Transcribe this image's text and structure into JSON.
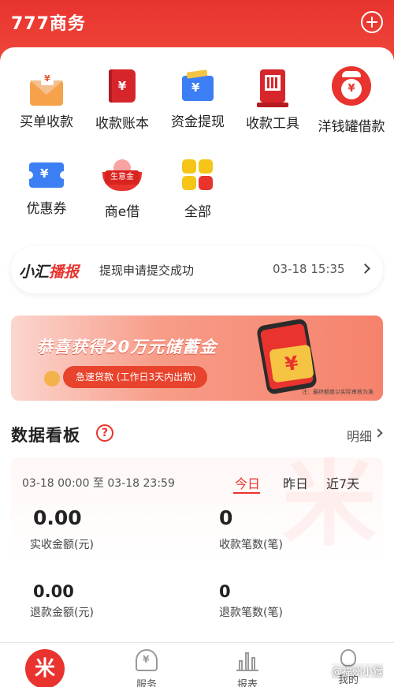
{
  "header": {
    "title": "777商务"
  },
  "services": [
    {
      "label": "买单收款",
      "glyph": "¥"
    },
    {
      "label": "收款账本",
      "glyph": "¥"
    },
    {
      "label": "资金提现",
      "glyph": "¥"
    },
    {
      "label": "收款工具",
      "glyph": ""
    },
    {
      "label": "洋钱罐借款",
      "glyph": "¥"
    },
    {
      "label": "优惠券",
      "glyph": "¥"
    },
    {
      "label": "商e借",
      "glyph": "生意金"
    },
    {
      "label": "全部",
      "glyph": ""
    }
  ],
  "broadcast": {
    "logo_black": "小汇",
    "logo_red": "播报",
    "message": "提现申请提交成功",
    "time": "03-18 15:35"
  },
  "banner": {
    "title": "恭喜获得20万元储蓄金",
    "pill": "急速贷款 (工作日3天内出款)",
    "yuan": "¥",
    "note": "注：最终额度以实际审核为准"
  },
  "dashboard": {
    "title": "数据看板",
    "help": "?",
    "detail": "明细",
    "date_range": "03-18 00:00 至 03-18 23:59",
    "tabs": [
      "今日",
      "昨日",
      "近7天"
    ],
    "active_tab": "今日",
    "watermark": "米",
    "stats": [
      {
        "value": "0.00",
        "label": "实收金额(元)"
      },
      {
        "value": "0",
        "label": "收款笔数(笔)"
      },
      {
        "value": "0.00",
        "label": "退款金额(元)"
      },
      {
        "value": "0",
        "label": "退款笔数(笔)"
      }
    ]
  },
  "tabbar": {
    "home_glyph": "米",
    "items": [
      {
        "label": "服务",
        "icon": "heart-yuan-icon",
        "glyph": "¥"
      },
      {
        "label": "报表",
        "icon": "bar-chart-icon"
      },
      {
        "label": "我的",
        "icon": "person-icon"
      }
    ]
  },
  "overlay_watermark": "@福州小猴",
  "colors": {
    "brand_red": "#e8332e",
    "blue": "#3c7ef3",
    "gold": "#f5c518"
  }
}
